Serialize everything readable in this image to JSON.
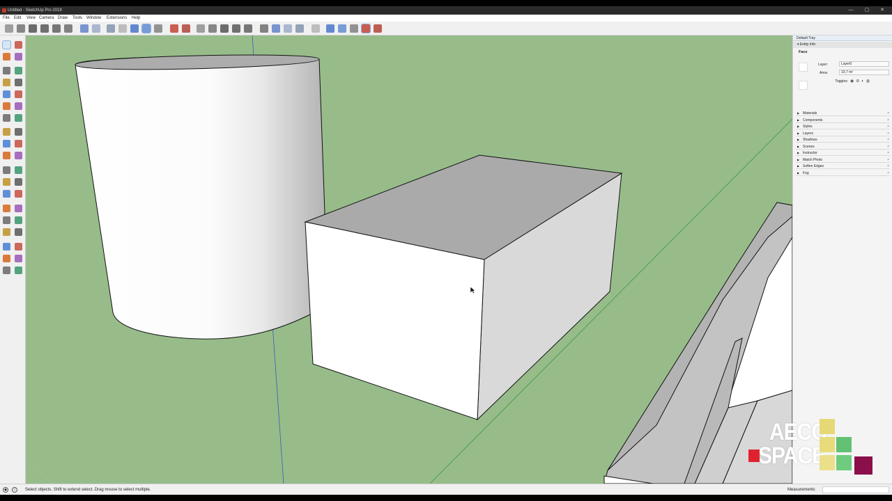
{
  "window": {
    "title": "Untitled - SketchUp Pro 2019",
    "controls": [
      "minimize",
      "maximize",
      "close"
    ]
  },
  "menu": [
    "File",
    "Edit",
    "View",
    "Camera",
    "Draw",
    "Tools",
    "Window",
    "Extensions",
    "Help"
  ],
  "toolbar": {
    "tools": [
      {
        "name": "iso-view",
        "icon": "iso-house-icon"
      },
      {
        "name": "top-view",
        "icon": "top-view-icon"
      },
      {
        "name": "front-view",
        "icon": "front-view-icon"
      },
      {
        "name": "right-view",
        "icon": "right-view-icon"
      },
      {
        "name": "back-view",
        "icon": "back-view-icon"
      },
      {
        "name": "left-view",
        "icon": "left-view-icon"
      },
      {
        "name": "xray",
        "icon": "xray-icon"
      },
      {
        "name": "back-edges",
        "icon": "back-edges-icon"
      },
      {
        "name": "wireframe",
        "icon": "wireframe-icon"
      },
      {
        "name": "hidden-line",
        "icon": "hidden-line-icon"
      },
      {
        "name": "shaded",
        "icon": "shaded-icon"
      },
      {
        "name": "shaded-textures",
        "icon": "shaded-textures-icon"
      },
      {
        "name": "monochrome",
        "icon": "monochrome-icon"
      },
      {
        "name": "warehouse",
        "icon": "warehouse-icon"
      },
      {
        "name": "extension-warehouse",
        "icon": "extension-warehouse-icon"
      }
    ],
    "selected_tool": "shaded"
  },
  "left_tools": [
    "select-arrow-icon",
    "make-component-icon",
    "paint-bucket-icon",
    "eraser-icon",
    "line-icon",
    "freehand-icon",
    "rectangle-icon",
    "rotated-rectangle-icon",
    "circle-icon",
    "polygon-icon",
    "arc-icon",
    "pie-icon",
    "move-icon",
    "push-pull-icon",
    "rotate-icon",
    "follow-me-icon",
    "scale-icon",
    "offset-icon",
    "tape-measure-icon",
    "dimension-icon",
    "protractor-icon",
    "text-icon",
    "axes-icon",
    "3d-text-icon",
    "orbit-icon",
    "pan-icon",
    "zoom-icon",
    "zoom-window-icon",
    "zoom-extents-icon",
    "previous-icon",
    "position-camera-icon",
    "look-around-icon",
    "walk-icon",
    "section-plane-icon",
    "sandbox-icon",
    "shadow-icon"
  ],
  "tray": {
    "title": "Default Tray",
    "entity_info": {
      "header": "Entity Info",
      "type": "Face",
      "layer_label": "Layer:",
      "layer_value": "Layer0",
      "area_label": "Area:",
      "area_value": "10,7 m²",
      "toggles_label": "Toggles:"
    },
    "panels": [
      "Materials",
      "Components",
      "Styles",
      "Layers",
      "Shadows",
      "Scenes",
      "Instructor",
      "Match Photo",
      "Soften Edges",
      "Fog"
    ]
  },
  "status": {
    "message": "Select objects. Shift to extend select. Drag mouse to select multiple.",
    "measurements_label": "Measurements",
    "measurements_value": ""
  },
  "logo": {
    "line1": "AECO",
    "line2": "SPACE"
  },
  "colors": {
    "ground": "#97bc8a",
    "face_light": "#ffffff",
    "face_shaded": "#d9d9d9",
    "face_top": "#aeaeae",
    "logo_red": "#e02230",
    "logo_yellow": "#e6d874",
    "logo_green": "#63c173",
    "logo_purple": "#8a0f4a"
  }
}
